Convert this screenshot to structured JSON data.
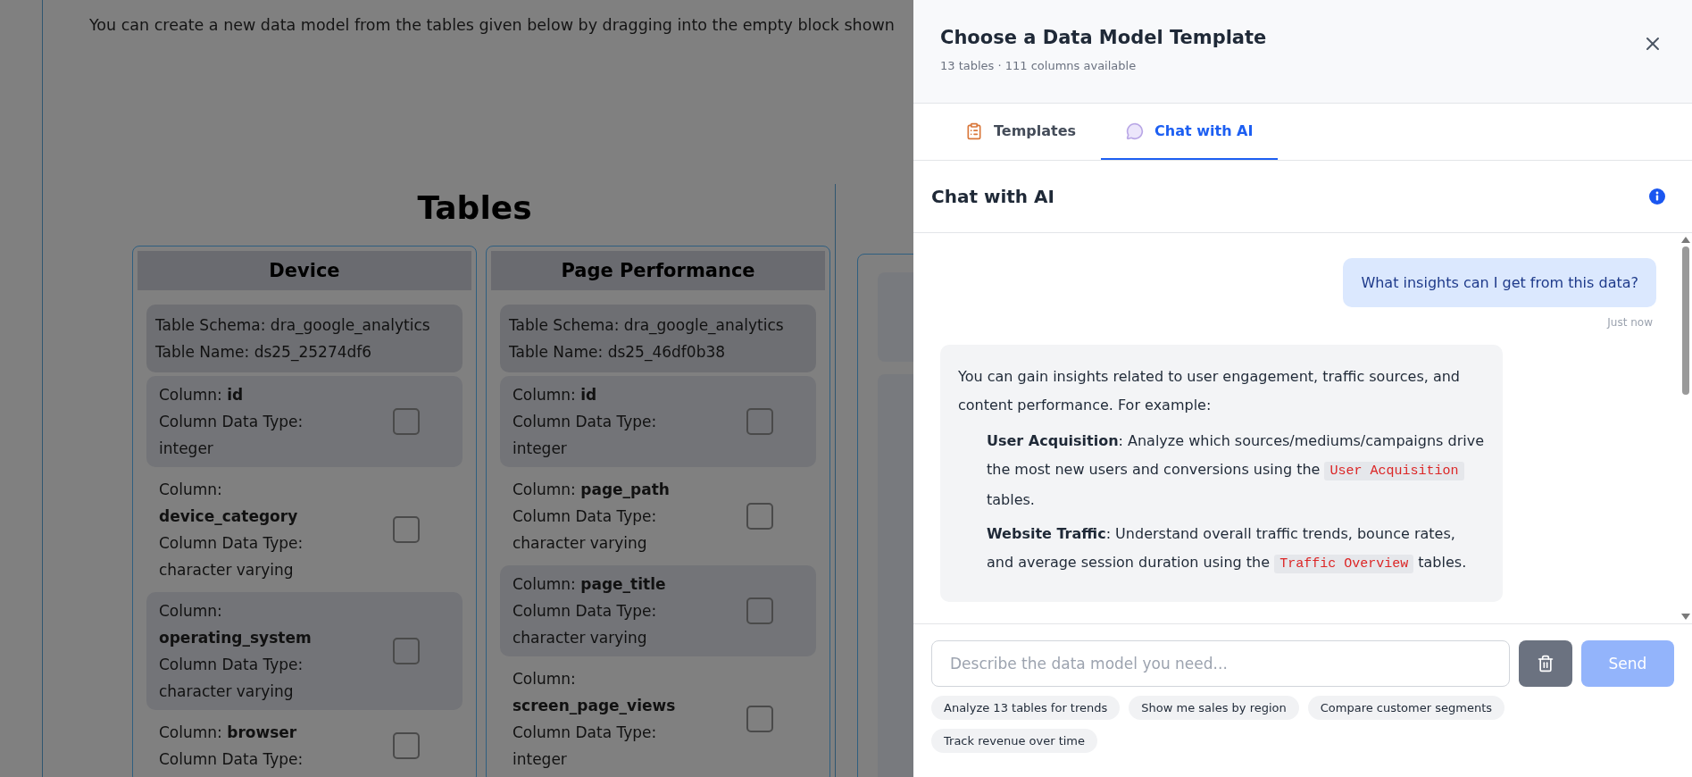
{
  "page": {
    "intro": "You can create a new data model from the tables given below by dragging into the empty block shown",
    "tables_heading": "Tables",
    "tables": [
      {
        "name": "Device",
        "schema": "Table Schema: dra_google_analytics",
        "table_name": "Table Name: ds25_25274df6",
        "columns": [
          {
            "column": "Column: **id**",
            "type": "Column Data Type: integer",
            "checked": false
          },
          {
            "column": "Column: **device_category**",
            "type": "Column Data Type: character varying",
            "checked": false
          },
          {
            "column": "Column: **operating_system**",
            "type": "Column Data Type: character varying",
            "checked": false
          },
          {
            "column": "Column: **browser**",
            "type": "Column Data Type:",
            "checked": false
          }
        ]
      },
      {
        "name": "Page Performance",
        "schema": "Table Schema: dra_google_analytics",
        "table_name": "Table Name: ds25_46df0b38",
        "columns": [
          {
            "column": "Column: **id**",
            "type": "Column Data Type: integer",
            "checked": false
          },
          {
            "column": "Column: **page_path**",
            "type": "Column Data Type: character varying",
            "checked": false
          },
          {
            "column": "Column: **page_title**",
            "type": "Column Data Type: character varying",
            "checked": false
          },
          {
            "column": "Column: **screen_page_views**",
            "type": "Column Data Type: integer",
            "checked": false
          }
        ]
      }
    ]
  },
  "dialog": {
    "title": "Choose a Data Model Template",
    "subtitle": "13 tables · 111 columns available",
    "tabs": [
      {
        "label": "Templates",
        "kind": "clipboard",
        "selected": false
      },
      {
        "label": "Chat with AI",
        "kind": "chat",
        "selected": true
      }
    ],
    "chat_title": "Chat with AI",
    "messages": [
      {
        "kind": "user",
        "text": "What insights can I get from this data?",
        "time": "Just now"
      },
      {
        "kind": "ai",
        "intro": "You can gain insights related to user engagement, traffic sources, and content performance. For example:",
        "items": [
          {
            "text": "**User Acquisition**: Analyze which sources/mediums/campaigns drive the most new users and conversions using the",
            "code": "User Acquisition",
            "after": "tables."
          },
          {
            "text": "**Website Traffic**: Understand overall traffic trends, bounce rates, and average session duration using the",
            "code": "Traffic Overview",
            "after": "tables."
          }
        ]
      }
    ],
    "input_placeholder": "Describe the data model you need...",
    "send": {
      "label": "Send",
      "disabled": true
    },
    "suggestions": [
      "Analyze 13 tables for trends",
      "Show me sales by region",
      "Compare customer segments",
      "Track revenue over time"
    ]
  }
}
